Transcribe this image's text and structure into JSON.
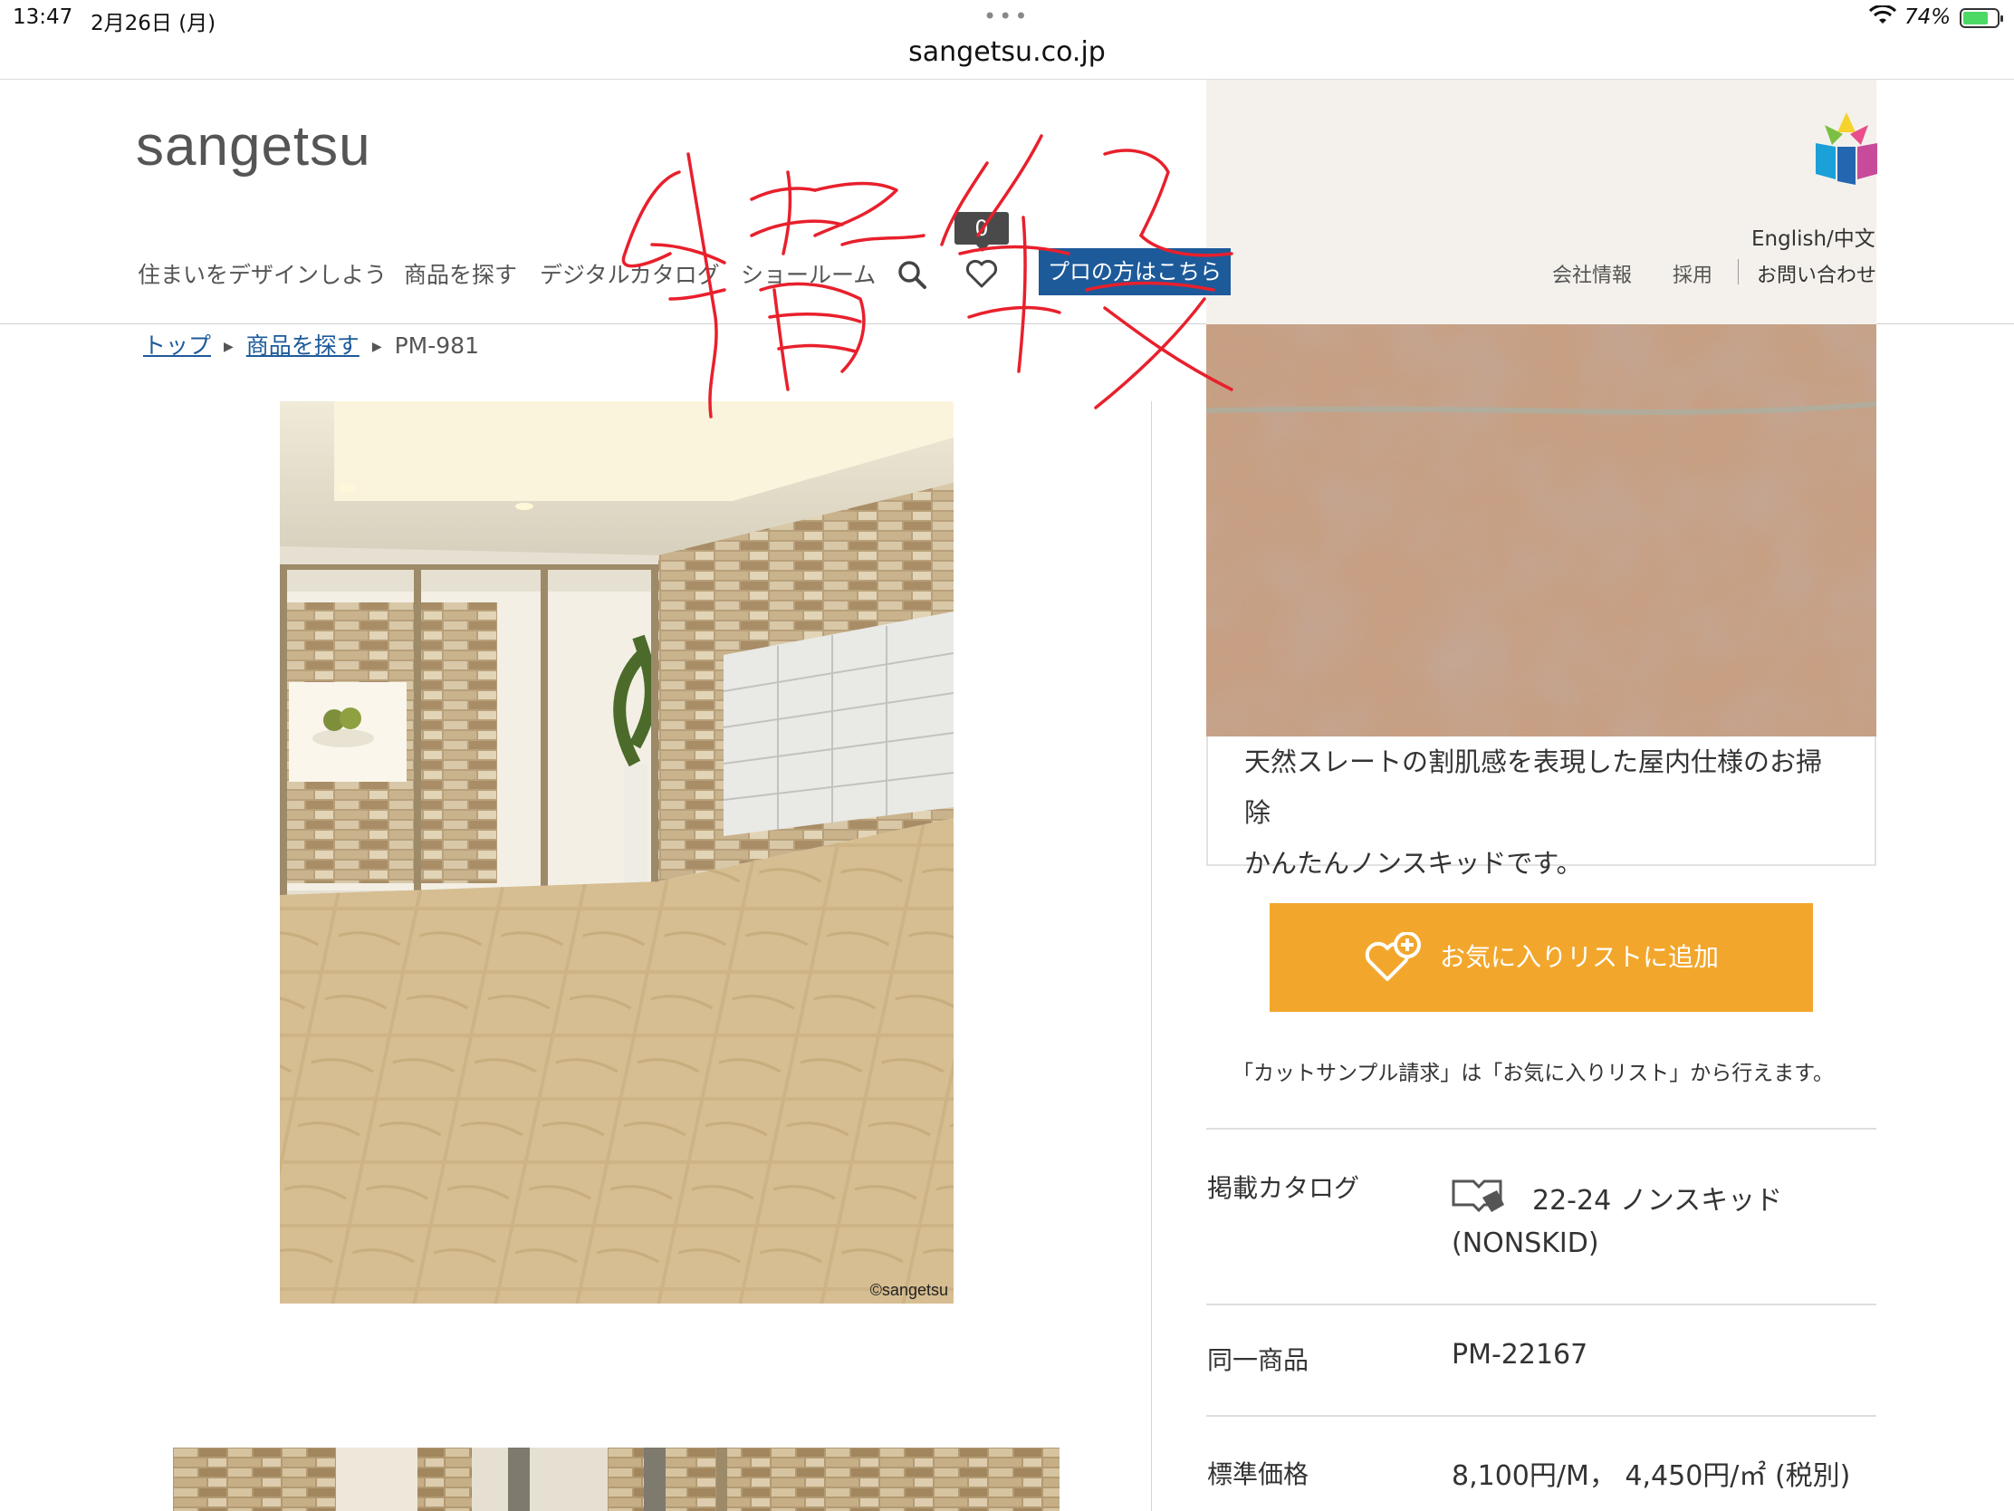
{
  "status_bar": {
    "time": "13:47",
    "date": "2月26日 (月)",
    "dots": "•••",
    "url": "sangetsu.co.jp",
    "battery_pct": "74%",
    "battery_level": 0.74
  },
  "header": {
    "logo": "sangetsu",
    "nav": [
      "住まいをデザインしよう",
      "商品を探す",
      "デジタルカタログ",
      "ショールーム"
    ],
    "favorites_count": "0",
    "pro_button": "プロの方はこちら",
    "language": "English/中文",
    "util_links": [
      "会社情報",
      "採用",
      "お問い合わせ"
    ]
  },
  "breadcrumb": {
    "items": [
      "トップ",
      "商品を探す"
    ],
    "current": "PM-981"
  },
  "main_image": {
    "copyright": "©sangetsu"
  },
  "product": {
    "description_lines": [
      "天然スレートの割肌感を表現した屋内仕様のお掃除",
      "かんたんノンスキッドです。"
    ],
    "favorite_button": "お気に入りリストに追加",
    "note": "「カットサンプル請求」は「お気に入りリスト」から行えます。",
    "specs": {
      "catalog_label": "掲載カタログ",
      "catalog_line1": "22-24 ノンスキッド",
      "catalog_line2": "(NONSKID)",
      "same_label": "同一商品",
      "same_value": "PM-22167",
      "price_label": "標準価格",
      "price_value": "8,100円/M， 4,450円/㎡ (税別)"
    }
  },
  "colors": {
    "brand_blue": "#1d5a9a",
    "button_orange": "#f2a72c",
    "annotation_red": "#e8202c"
  },
  "icons": [
    "search-icon",
    "heart-icon",
    "heart-plus-icon",
    "catalog-book-icon",
    "wifi-icon",
    "battery-icon",
    "sangetsu-brand-mark-icon"
  ]
}
